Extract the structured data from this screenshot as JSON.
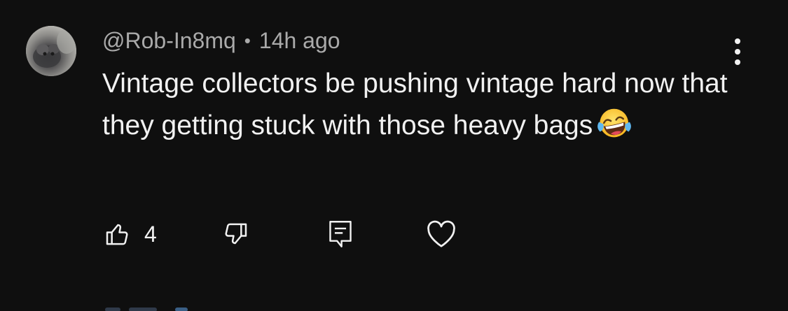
{
  "comment": {
    "author": "@Rob-In8mq",
    "separator": "•",
    "timestamp": "14h ago",
    "text": "Vintage collectors be pushing vintage hard now that they getting stuck with those heavy bags",
    "emoji": "face-with-tears-of-joy"
  },
  "actions": {
    "like_count": "4",
    "like_icon": "thumbs-up-icon",
    "dislike_icon": "thumbs-down-icon",
    "reply_icon": "reply-comment-icon",
    "heart_icon": "heart-icon"
  },
  "menu_icon": "more-vertical-icon",
  "colors": {
    "background": "#0f0f0f",
    "primary_text": "#f1f1f1",
    "secondary_text": "#aaaaaa"
  }
}
